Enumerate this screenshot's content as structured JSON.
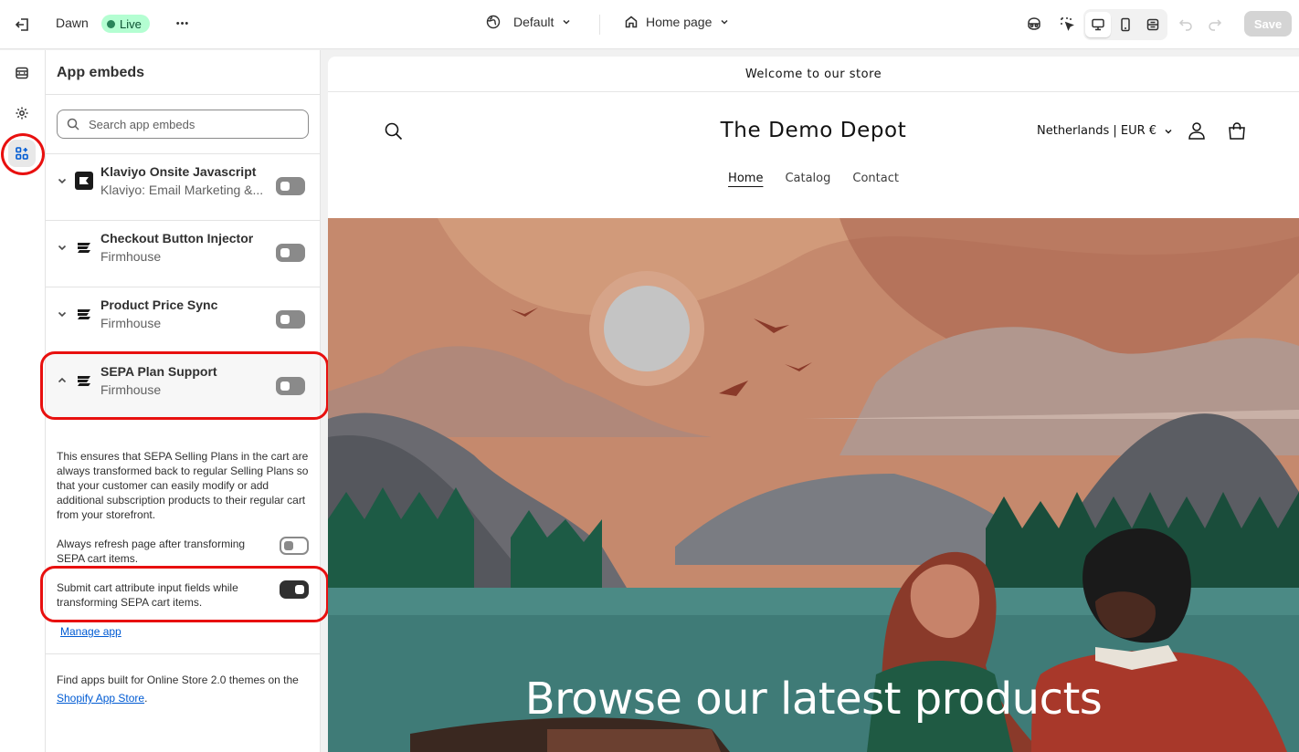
{
  "topbar": {
    "theme_name": "Dawn",
    "live_label": "Live",
    "more_label": "•••",
    "template_label": "Default",
    "page_label": "Home page",
    "save_label": "Save"
  },
  "panel": {
    "title": "App embeds",
    "search_placeholder": "Search app embeds",
    "embeds": [
      {
        "name": "Klaviyo Onsite Javascript",
        "sub": "Klaviyo: Email Marketing &...",
        "enabled": false
      },
      {
        "name": "Checkout Button Injector",
        "sub": "Firmhouse",
        "enabled": false
      },
      {
        "name": "Product Price Sync",
        "sub": "Firmhouse",
        "enabled": false
      },
      {
        "name": "SEPA Plan Support",
        "sub": "Firmhouse",
        "enabled": false,
        "expanded": true
      }
    ],
    "sepa_description": "This ensures that SEPA Selling Plans in the cart are always transformed back to regular Selling Plans so that your customer can easily modify or add additional subscription products to their regular cart from your storefront.",
    "options": [
      {
        "label": "Always refresh page after transforming SEPA cart items.",
        "enabled": false
      },
      {
        "label": "Submit cart attribute input fields while transforming SEPA cart items.",
        "enabled": true
      }
    ],
    "manage_app_label": "Manage app",
    "footer_prefix": "Find apps built for Online Store 2.0 themes on the ",
    "footer_link": "Shopify App Store",
    "footer_suffix": "."
  },
  "preview": {
    "announcement": "Welcome to our store",
    "store_name": "The Demo Depot",
    "locale": "Netherlands | EUR €",
    "nav": [
      "Home",
      "Catalog",
      "Contact"
    ],
    "hero_heading": "Browse our latest products"
  },
  "colors": {
    "highlight": "#e8100f",
    "live_badge": "#b4fed2",
    "link": "#005bd3"
  }
}
